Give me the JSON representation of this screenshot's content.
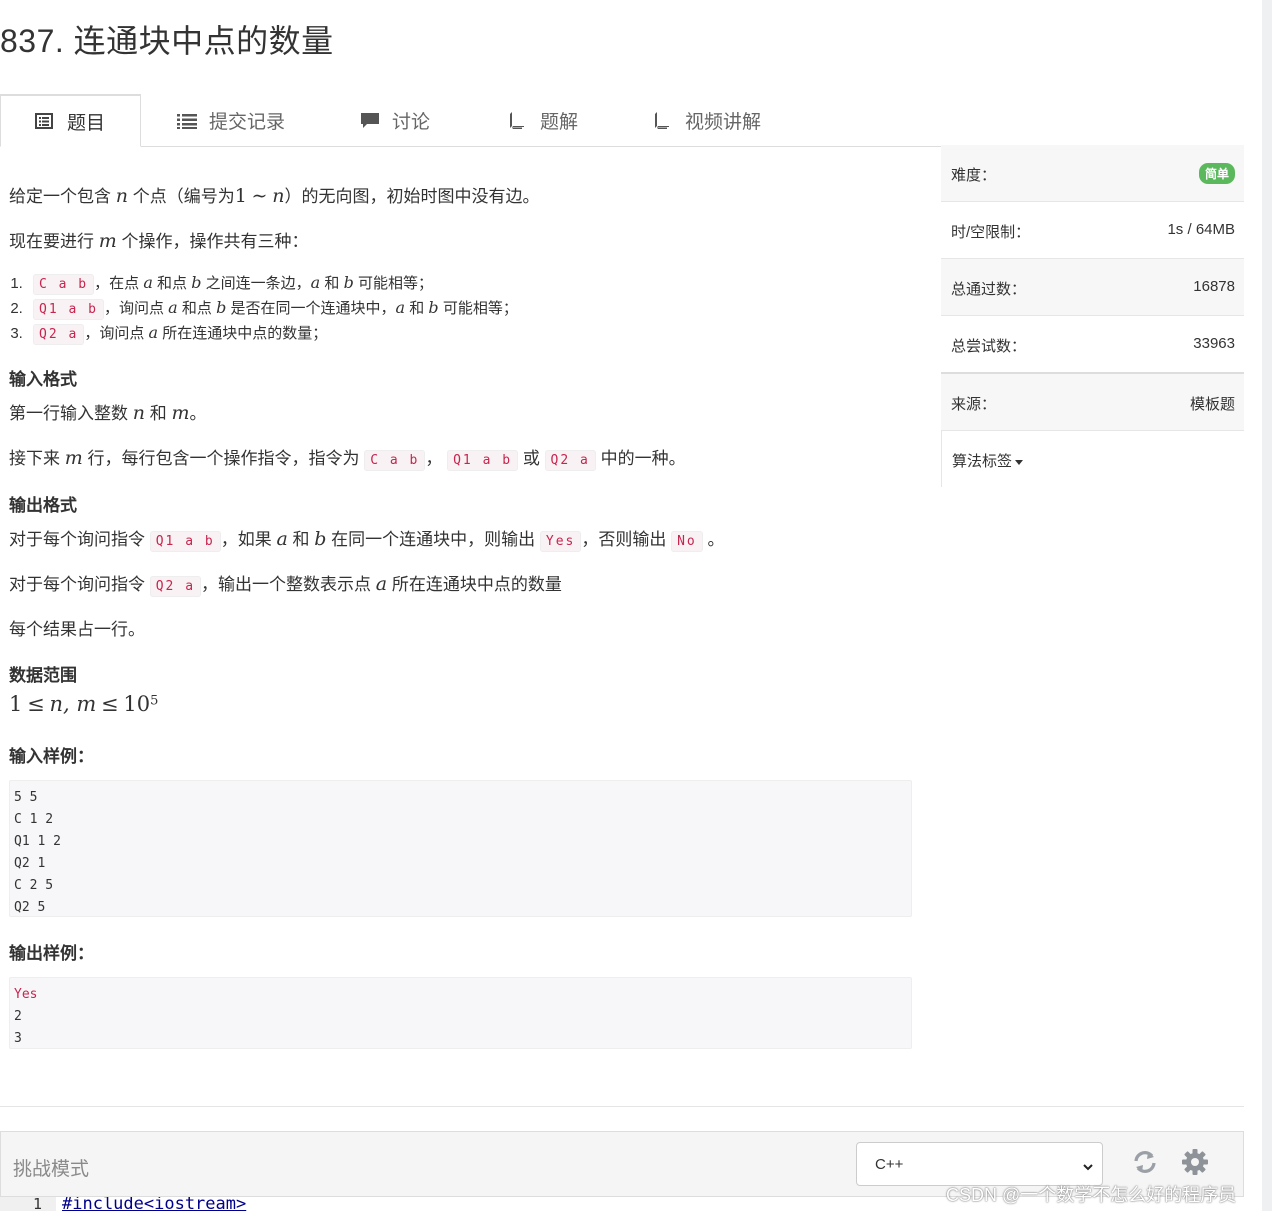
{
  "title": "837. 连通块中点的数量",
  "tabs": [
    {
      "label": "题目",
      "icon": "list-alt-icon"
    },
    {
      "label": "提交记录",
      "icon": "list-icon"
    },
    {
      "label": "讨论",
      "icon": "comment-icon"
    },
    {
      "label": "题解",
      "icon": "book-icon"
    },
    {
      "label": "视频讲解",
      "icon": "book-icon"
    }
  ],
  "problem": {
    "p1": {
      "a": "给定一个包含",
      "n": "n",
      "b": "个点（编号为",
      "r1": "1",
      "tilde": "∼",
      "r2": "n",
      "c": "）的无向图，初始时图中没有边。"
    },
    "p2": {
      "a": "现在要进行",
      "m": "m",
      "b": "个操作，操作共有三种："
    },
    "ops": [
      {
        "num": "1.",
        "code": "C a b",
        "a": "，在点",
        "v1": "a",
        "b": "和点",
        "v2": "b",
        "c": "之间连一条边，",
        "v3": "a",
        "d": "和",
        "v4": "b",
        "e": "可能相等；"
      },
      {
        "num": "2.",
        "code": "Q1 a b",
        "a": "，询问点",
        "v1": "a",
        "b": "和点",
        "v2": "b",
        "c": "是否在同一个连通块中，",
        "v3": "a",
        "d": "和",
        "v4": "b",
        "e": "可能相等；"
      },
      {
        "num": "3.",
        "code": "Q2 a",
        "a": "，询问点",
        "v1": "a",
        "b": "所在连通块中点的数量；"
      }
    ],
    "input_heading": "输入格式",
    "in1": {
      "a": "第一行输入整数",
      "n": "n",
      "b": "和",
      "m": "m",
      "c": "。"
    },
    "in2": {
      "a": "接下来",
      "m": "m",
      "b": "行，每行包含一个操作指令，指令为",
      "c1": "C a b",
      "s1": "，",
      "c2": "Q1 a b",
      "s2": "或",
      "c3": "Q2 a",
      "s3": "中的一种。"
    },
    "output_heading": "输出格式",
    "out1": {
      "a": "对于每个询问指令",
      "c1": "Q1 a b",
      "b": "，如果",
      "v1": "a",
      "c": "和",
      "v2": "b",
      "d": "在同一个连通块中，则输出",
      "y": "Yes",
      "e": "，否则输出",
      "no": "No",
      "f": "。"
    },
    "out2": {
      "a": "对于每个询问指令",
      "c1": "Q2 a",
      "b": "，输出一个整数表示点",
      "v1": "a",
      "c": "所在连通块中点的数量"
    },
    "out3": "每个结果占一行。",
    "range_heading": "数据范围",
    "range": {
      "one": "1",
      "le1": "≤",
      "nm": "n, m",
      "le2": "≤",
      "base": "10",
      "exp": "5"
    },
    "sample_in_heading": "输入样例：",
    "sample_in": "5 5\nC 1 2\nQ1 1 2\nQ2 1\nC 2 5\nQ2 5",
    "sample_out_heading": "输出样例：",
    "sample_out_first": "Yes",
    "sample_out_rest": "2\n3"
  },
  "sidebar": {
    "difficulty_label": "难度：",
    "difficulty_value": "简单",
    "limit_label": "时/空限制：",
    "limit_value": "1s / 64MB",
    "passed_label": "总通过数：",
    "passed_value": "16878",
    "tried_label": "总尝试数：",
    "tried_value": "33963",
    "source_label": "来源：",
    "source_value": "模板题",
    "tags_label": "算法标签"
  },
  "editor": {
    "mode_label": "挑战模式",
    "language": "C++",
    "line_number": "1",
    "first_line": "#include<iostream>"
  },
  "watermark": "CSDN @一个数学不怎么好的程序员",
  "colors": {
    "accent_green": "#5cb85c",
    "code_red": "#c7254e"
  }
}
